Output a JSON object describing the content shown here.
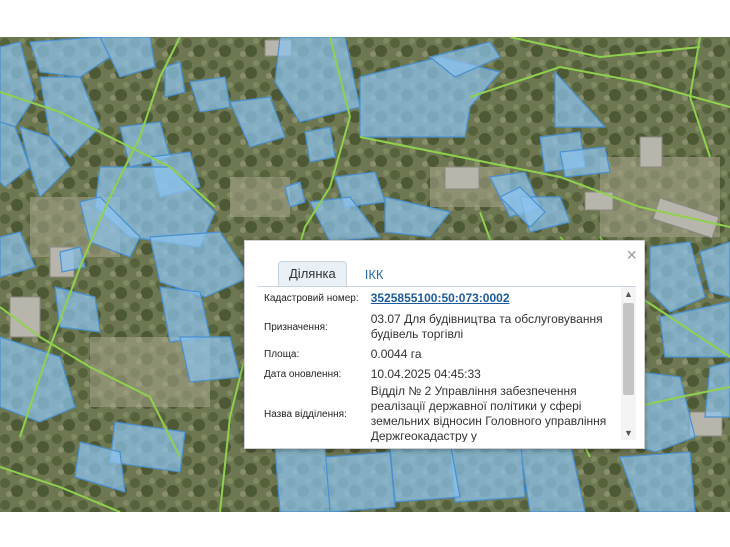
{
  "popup": {
    "close_symbol": "×",
    "tabs": [
      {
        "label": "Ділянка",
        "active": true
      },
      {
        "label": "ІКК",
        "active": false
      }
    ],
    "fields": {
      "cadastral_label": "Кадастровий номер:",
      "cadastral_value": "3525855100:50:073:0002",
      "purpose_label": "Призначення:",
      "purpose_value": "03.07 Для будівництва та обслуговування будівель торгівлі",
      "area_label": "Площа:",
      "area_value": "0.0044 га",
      "updated_label": "Дата оновлення:",
      "updated_value": "10.04.2025 04:45:33",
      "department_label": "Назва відділення:",
      "department_value": "Відділ № 2 Управління забезпечення реалізації державної політики у сфері земельних відносин Головного управління Держгеокадастру у"
    },
    "scroll_position_fraction": 0.0
  },
  "colors": {
    "parcel_fill": "#8cc3ee",
    "parcel_stroke": "#4a90cf",
    "boundary_line": "#8fd14f",
    "link": "#1d5a9c"
  },
  "icons": {
    "close": "close-icon",
    "scroll_up": "chevron-up-icon",
    "scroll_down": "chevron-down-icon"
  }
}
